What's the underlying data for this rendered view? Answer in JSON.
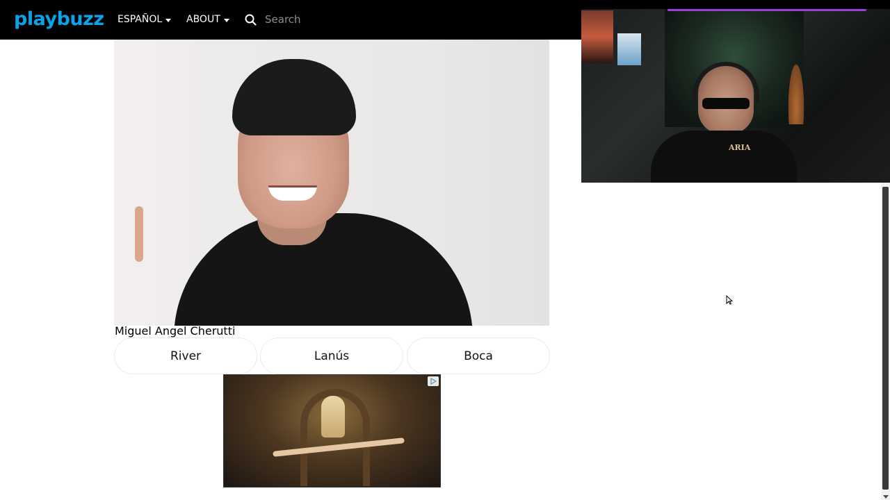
{
  "header": {
    "logo_text": "playbuzz",
    "nav": [
      {
        "label": "ESPAÑOL"
      },
      {
        "label": "ABOUT"
      }
    ],
    "search": {
      "placeholder": "Search",
      "value": ""
    }
  },
  "quiz": {
    "caption": "Miguel Angel Cherutti",
    "answers": [
      {
        "label": "River"
      },
      {
        "label": "Lanús"
      },
      {
        "label": "Boca"
      }
    ]
  },
  "webcam": {
    "shirt_text": "ARIA"
  },
  "icons": {
    "search": "search-icon",
    "caret": "caret-down-icon",
    "ad_choice": "ad-choices-icon",
    "cursor": "mouse-cursor-icon"
  },
  "colors": {
    "topbar": "#000000",
    "logo": "#09a3e8",
    "logo_accent": "#b93cf6",
    "accent_purple": "#9b3de0",
    "answer_border": "#ececec"
  }
}
